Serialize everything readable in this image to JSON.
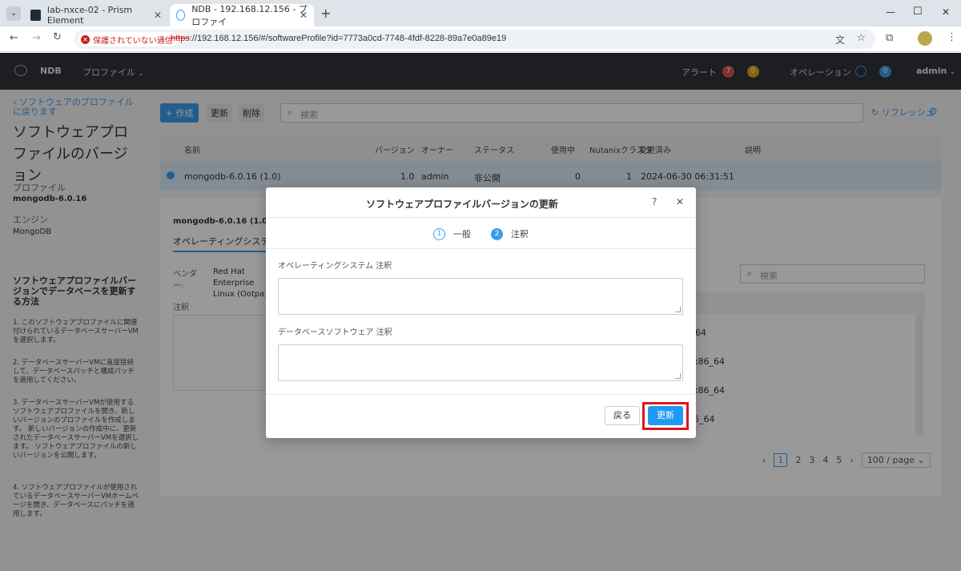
{
  "browser": {
    "tabs": [
      {
        "title": "lab-nxce-02 - Prism Element",
        "close": "✕"
      },
      {
        "title": "NDB - 192.168.12.156 - プロファイ",
        "close": "✕"
      }
    ],
    "new_tab": "+",
    "security_label": "保護されていない通信",
    "url_scheme": "https",
    "url_rest": "://192.168.12.156/#/softwareProfile?id=7773a0cd-7748-4fdf-8228-89a7e0a89e19",
    "window_controls": {
      "minimize": "—",
      "maximize": "☐",
      "close": "✕"
    }
  },
  "app": {
    "brand": "NDB",
    "menu": "プロファイル",
    "alerts_label": "アラート",
    "alerts_red": "7",
    "alerts_yellow": "0",
    "operations_label": "オペレーション",
    "operations_count": "0",
    "user": "admin"
  },
  "sidebar": {
    "back_link": "‹ ソフトウェアのプロファイルに戻ります",
    "page_title": "ソフトウェアプロファイルのバージョン",
    "profile_label": "プロファイル",
    "profile_value": "mongodb-6.0.16",
    "engine_label": "エンジン",
    "engine_value": "MongoDB",
    "help_title": "ソフトウェアプロファイルバージョンでデータベースを更新する方法",
    "help_steps": [
      "1. このソフトウェアプロファイルに関連付けられているデータベースサーバーVMを選択します。",
      "2. データベースサーバーVMに直接接続して、データベースパッチと構成パッチを適用してください。",
      "3. データベースサーバーVMが使用するソフトウェアプロファイルを開き、新しいバージョンのプロファイルを作成します。 新しいバージョンの作成中に、更新されたデータベースサーバーVMを選択します。 ソフトウェアプロファイルの新しいバージョンを公開します。",
      "4. ソフトウェアプロファイルが使用されているデータベースサーバーVMホームページを開き、データベースにパッチを適用します。"
    ]
  },
  "toolbar": {
    "create": "+ 作成",
    "update": "更新",
    "delete": "削除",
    "search_placeholder": "検索",
    "refresh": "リフレッシュ"
  },
  "table": {
    "headers": [
      "名前",
      "バージョン",
      "オーナー",
      "ステータス",
      "使用中",
      "Nutanixクラスタ",
      "変更済み",
      "説明"
    ],
    "row": {
      "name": "mongodb-6.0.16 (1.0)",
      "version": "1.0",
      "owner": "admin",
      "status": "非公開",
      "in_use": "0",
      "clusters": "1",
      "modified": "2024-06-30 06:31:51"
    }
  },
  "detail": {
    "title": "mongodb-6.0.16 (1.0) 詳細",
    "tab": "オペレーティングシステム",
    "vendor_label": "ベンダー:",
    "vendor_value": "Red Hat Enterprise Linux (Ootpa)",
    "notes_label": "注釈",
    "search_placeholder": "検索",
    "packages": [
      "x86_64",
      "8_9.x86_64",
      "8_9.x86_64",
      "9.x86_64"
    ],
    "pagination": [
      "‹",
      "1",
      "2",
      "3",
      "4",
      "5",
      "›"
    ],
    "per_page": "100 / page"
  },
  "modal": {
    "title": "ソフトウェアプロファイルバージョンの更新",
    "help": "?",
    "close": "✕",
    "steps": [
      {
        "num": "1",
        "label": "一般"
      },
      {
        "num": "2",
        "label": "注釈"
      }
    ],
    "os_notes_label": "オペレーティングシステム 注釈",
    "db_notes_label": "データベースソフトウェア 注釈",
    "back_button": "戻る",
    "update_button": "更新",
    "highlight_color": "#e0141e"
  }
}
